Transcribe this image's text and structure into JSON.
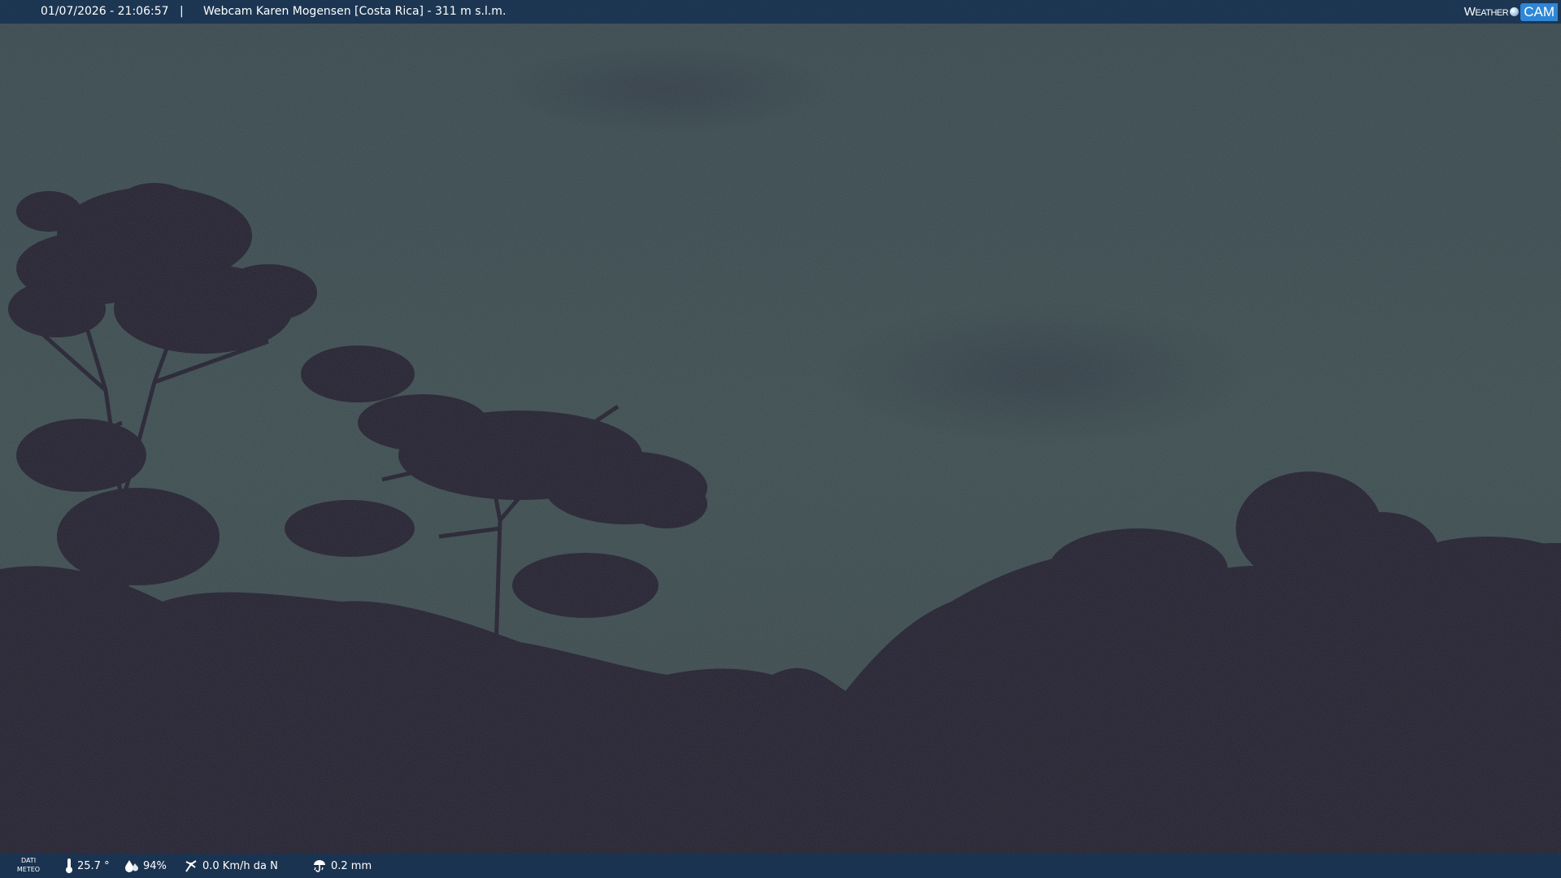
{
  "top_bar": {
    "datetime": "01/07/2026 - 21:06:57",
    "separator": "|",
    "title": "Webcam Karen Mogensen [Costa Rica] - 311 m s.l.m."
  },
  "logo": {
    "weather": "Weather",
    "cam": "CAM"
  },
  "bottom_bar": {
    "meteo_label_line1": "DATI",
    "meteo_label_line2": "METEO",
    "temperature": "25.7 °",
    "humidity": "94%",
    "wind": "0.0 Km/h da N",
    "rain": "0.2 mm"
  },
  "icons": {
    "temperature": "thermometer-icon",
    "humidity": "humidity-drop-icon",
    "wind": "wind-icon",
    "rain": "rain-icon"
  },
  "colors": {
    "bar_background": "#193452",
    "sky": "#3b4a50",
    "vegetation": "#211e2c"
  }
}
